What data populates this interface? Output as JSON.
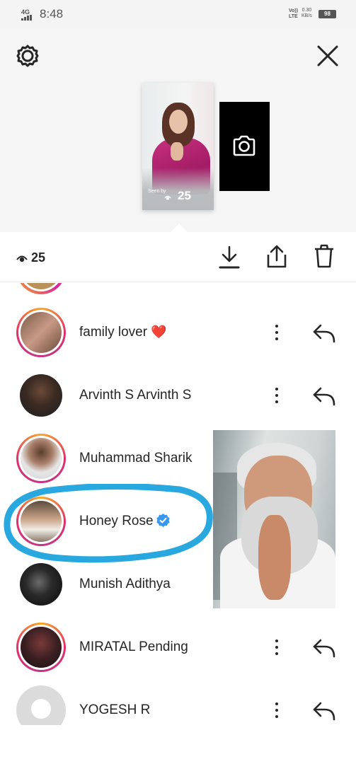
{
  "status_bar": {
    "network": "4G",
    "time": "8:48",
    "carrier": "Vo)) LTE",
    "speed_value": "0.30",
    "speed_unit": "KB/s",
    "battery": "98"
  },
  "story": {
    "thumbnail_caption": "Seen by",
    "thumbnail_views": "25"
  },
  "action_bar": {
    "views": "25"
  },
  "viewers": [
    {
      "name": "family lover",
      "emoji": "❤️"
    },
    {
      "name": "Arvinth S Arvinth S"
    },
    {
      "name": "Muhammad Sharik"
    },
    {
      "name": "Honey Rose",
      "verified": true
    },
    {
      "name": "Munish Adithya"
    },
    {
      "name": "MIRATAL Pending"
    },
    {
      "name": "YOGESH R"
    }
  ],
  "colors": {
    "ring_start": "#f9a825",
    "ring_end": "#c13584",
    "verified_blue": "#3897f0",
    "heart_red": "#e0245e",
    "highlight_scribble": "#29a8e0"
  },
  "icons": {
    "settings": "gear-icon",
    "close": "close-icon",
    "camera": "camera-icon",
    "download": "download-icon",
    "share": "share-icon",
    "delete": "trash-icon",
    "more": "more-vertical-icon",
    "reply": "reply-icon",
    "views": "eye-icon"
  }
}
